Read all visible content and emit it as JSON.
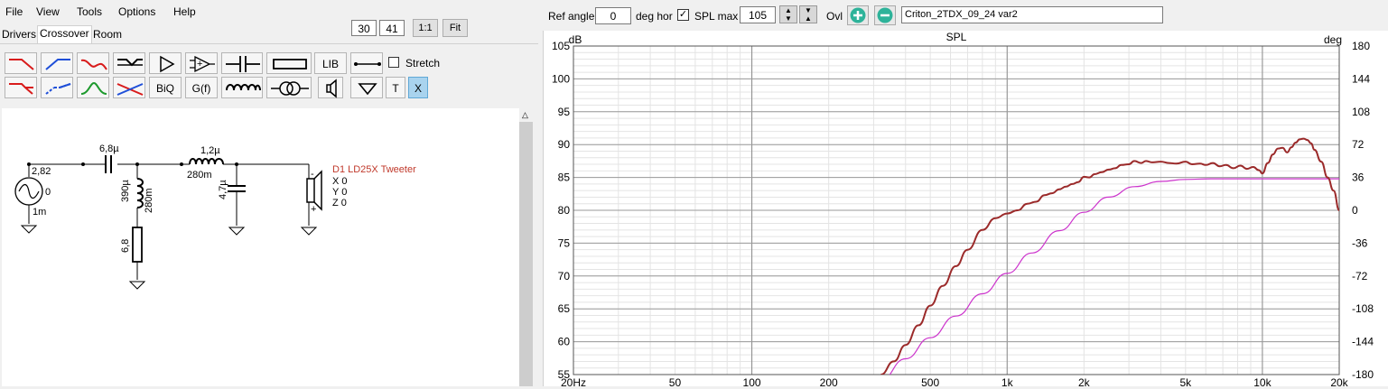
{
  "menu": [
    "File",
    "View",
    "Tools",
    "Options",
    "Help"
  ],
  "toolbar": {
    "field1": "30",
    "field2": "41",
    "one_to_one": "1:1",
    "fit": "Fit"
  },
  "tabs": [
    "Drivers",
    "Crossover",
    "Room"
  ],
  "active_tab": "Crossover",
  "palette": {
    "lib": "LIB",
    "biq": "BiQ",
    "gf": "G(f)",
    "t": "T",
    "x": "X",
    "stretch_label": "Stretch",
    "stretch_checked": false
  },
  "schematic": {
    "src_top": "2,82",
    "src_side": "0",
    "src_bottom": "1m",
    "c1": "6,8µ",
    "l1_a": "390µ",
    "l1_b": "280m",
    "r1": "6,8",
    "l2_a": "1,2µ",
    "l2_b": "280m",
    "c2": "4,7µ",
    "drv_name": "D1 LD25X Tweeter",
    "drv_x": "X 0",
    "drv_y": "Y 0",
    "drv_z": "Z 0",
    "minus": "-",
    "plus": "+"
  },
  "spl_bar": {
    "ref_angle_label": "Ref angle",
    "ref_angle_value": "0",
    "deg_hor": "deg hor",
    "spl_max_label": "SPL max",
    "spl_max_checked": true,
    "spl_max_value": "105",
    "ovl_label": "Ovl",
    "project_name": "Criton_2TDX_09_24 var2"
  },
  "chart_data": {
    "type": "line",
    "title": "SPL",
    "ylabel": "dB",
    "y2label": "deg",
    "xscale": "log",
    "xlim": [
      20,
      20000
    ],
    "ylim": [
      55,
      105
    ],
    "y2lim": [
      -180,
      180
    ],
    "xticks": [
      {
        "v": 20,
        "t": "20Hz"
      },
      {
        "v": 50,
        "t": "50"
      },
      {
        "v": 100,
        "t": "100"
      },
      {
        "v": 200,
        "t": "200"
      },
      {
        "v": 500,
        "t": "500"
      },
      {
        "v": 1000,
        "t": "1k"
      },
      {
        "v": 2000,
        "t": "2k"
      },
      {
        "v": 5000,
        "t": "5k"
      },
      {
        "v": 10000,
        "t": "10k"
      },
      {
        "v": 20000,
        "t": "20k"
      }
    ],
    "yticks": [
      105,
      100,
      95,
      90,
      85,
      80,
      75,
      70,
      65,
      60,
      55
    ],
    "y2ticks": [
      180,
      144,
      108,
      72,
      36,
      0,
      -36,
      -72,
      -108,
      -144,
      -180
    ],
    "grid": true,
    "colors": {
      "spl": "#9b2a2a",
      "target": "#cc33cc"
    },
    "series": [
      {
        "key": "spl",
        "x": [
          320,
          360,
          400,
          450,
          500,
          560,
          630,
          700,
          800,
          900,
          1000,
          1100,
          1200,
          1300,
          1400,
          1500,
          1600,
          1700,
          1800,
          1900,
          2000,
          2100,
          2200,
          2350,
          2500,
          2650,
          2800,
          3000,
          3150,
          3350,
          3500,
          3700,
          4000,
          4300,
          4600,
          5000,
          5300,
          5700,
          6000,
          6400,
          6800,
          7200,
          7700,
          8200,
          8700,
          9200,
          9700,
          10000,
          10500,
          11000,
          11500,
          12000,
          12500,
          13000,
          13500,
          14000,
          14500,
          15000,
          15500,
          16000,
          17000,
          18000,
          19000,
          20000
        ],
        "values": [
          55,
          57,
          59.5,
          62.5,
          65.5,
          68.5,
          71.5,
          74,
          77,
          78.8,
          79.5,
          80,
          81,
          81.3,
          82.3,
          82.6,
          83.2,
          83.6,
          84,
          84.3,
          85.1,
          85,
          85.5,
          85.8,
          86.2,
          86.4,
          86.9,
          87,
          87.5,
          87.2,
          87.5,
          87.3,
          87.4,
          87.2,
          87.1,
          87.4,
          87,
          87.1,
          86.9,
          87.2,
          86.7,
          86.9,
          86.4,
          86.8,
          86.3,
          86.6,
          86.1,
          85.6,
          87.2,
          88.5,
          89.4,
          89.5,
          88.8,
          89.6,
          90.3,
          90.8,
          90.9,
          90.7,
          90.2,
          89.2,
          87.4,
          85,
          83,
          80
        ]
      },
      {
        "key": "target",
        "x": [
          320,
          400,
          500,
          630,
          800,
          1000,
          1250,
          1600,
          2000,
          2500,
          3150,
          4000,
          5000,
          6300,
          8000,
          10000,
          20000
        ],
        "values": [
          54.2,
          57.4,
          60.6,
          63.9,
          67.3,
          70.4,
          73.5,
          76.9,
          79.7,
          82,
          83.6,
          84.4,
          84.7,
          84.8,
          84.8,
          84.8,
          84.8
        ]
      }
    ]
  }
}
